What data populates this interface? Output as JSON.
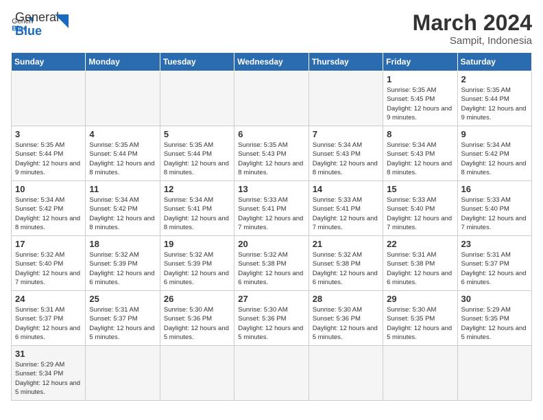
{
  "header": {
    "logo_general": "General",
    "logo_blue": "Blue",
    "month_year": "March 2024",
    "location": "Sampit, Indonesia"
  },
  "days_of_week": [
    "Sunday",
    "Monday",
    "Tuesday",
    "Wednesday",
    "Thursday",
    "Friday",
    "Saturday"
  ],
  "weeks": [
    [
      {
        "day": "",
        "info": ""
      },
      {
        "day": "",
        "info": ""
      },
      {
        "day": "",
        "info": ""
      },
      {
        "day": "",
        "info": ""
      },
      {
        "day": "",
        "info": ""
      },
      {
        "day": "1",
        "info": "Sunrise: 5:35 AM\nSunset: 5:45 PM\nDaylight: 12 hours and 9 minutes."
      },
      {
        "day": "2",
        "info": "Sunrise: 5:35 AM\nSunset: 5:44 PM\nDaylight: 12 hours and 9 minutes."
      }
    ],
    [
      {
        "day": "3",
        "info": "Sunrise: 5:35 AM\nSunset: 5:44 PM\nDaylight: 12 hours and 9 minutes."
      },
      {
        "day": "4",
        "info": "Sunrise: 5:35 AM\nSunset: 5:44 PM\nDaylight: 12 hours and 8 minutes."
      },
      {
        "day": "5",
        "info": "Sunrise: 5:35 AM\nSunset: 5:44 PM\nDaylight: 12 hours and 8 minutes."
      },
      {
        "day": "6",
        "info": "Sunrise: 5:35 AM\nSunset: 5:43 PM\nDaylight: 12 hours and 8 minutes."
      },
      {
        "day": "7",
        "info": "Sunrise: 5:34 AM\nSunset: 5:43 PM\nDaylight: 12 hours and 8 minutes."
      },
      {
        "day": "8",
        "info": "Sunrise: 5:34 AM\nSunset: 5:43 PM\nDaylight: 12 hours and 8 minutes."
      },
      {
        "day": "9",
        "info": "Sunrise: 5:34 AM\nSunset: 5:42 PM\nDaylight: 12 hours and 8 minutes."
      }
    ],
    [
      {
        "day": "10",
        "info": "Sunrise: 5:34 AM\nSunset: 5:42 PM\nDaylight: 12 hours and 8 minutes."
      },
      {
        "day": "11",
        "info": "Sunrise: 5:34 AM\nSunset: 5:42 PM\nDaylight: 12 hours and 8 minutes."
      },
      {
        "day": "12",
        "info": "Sunrise: 5:34 AM\nSunset: 5:41 PM\nDaylight: 12 hours and 8 minutes."
      },
      {
        "day": "13",
        "info": "Sunrise: 5:33 AM\nSunset: 5:41 PM\nDaylight: 12 hours and 7 minutes."
      },
      {
        "day": "14",
        "info": "Sunrise: 5:33 AM\nSunset: 5:41 PM\nDaylight: 12 hours and 7 minutes."
      },
      {
        "day": "15",
        "info": "Sunrise: 5:33 AM\nSunset: 5:40 PM\nDaylight: 12 hours and 7 minutes."
      },
      {
        "day": "16",
        "info": "Sunrise: 5:33 AM\nSunset: 5:40 PM\nDaylight: 12 hours and 7 minutes."
      }
    ],
    [
      {
        "day": "17",
        "info": "Sunrise: 5:32 AM\nSunset: 5:40 PM\nDaylight: 12 hours and 7 minutes."
      },
      {
        "day": "18",
        "info": "Sunrise: 5:32 AM\nSunset: 5:39 PM\nDaylight: 12 hours and 6 minutes."
      },
      {
        "day": "19",
        "info": "Sunrise: 5:32 AM\nSunset: 5:39 PM\nDaylight: 12 hours and 6 minutes."
      },
      {
        "day": "20",
        "info": "Sunrise: 5:32 AM\nSunset: 5:38 PM\nDaylight: 12 hours and 6 minutes."
      },
      {
        "day": "21",
        "info": "Sunrise: 5:32 AM\nSunset: 5:38 PM\nDaylight: 12 hours and 6 minutes."
      },
      {
        "day": "22",
        "info": "Sunrise: 5:31 AM\nSunset: 5:38 PM\nDaylight: 12 hours and 6 minutes."
      },
      {
        "day": "23",
        "info": "Sunrise: 5:31 AM\nSunset: 5:37 PM\nDaylight: 12 hours and 6 minutes."
      }
    ],
    [
      {
        "day": "24",
        "info": "Sunrise: 5:31 AM\nSunset: 5:37 PM\nDaylight: 12 hours and 6 minutes."
      },
      {
        "day": "25",
        "info": "Sunrise: 5:31 AM\nSunset: 5:37 PM\nDaylight: 12 hours and 5 minutes."
      },
      {
        "day": "26",
        "info": "Sunrise: 5:30 AM\nSunset: 5:36 PM\nDaylight: 12 hours and 5 minutes."
      },
      {
        "day": "27",
        "info": "Sunrise: 5:30 AM\nSunset: 5:36 PM\nDaylight: 12 hours and 5 minutes."
      },
      {
        "day": "28",
        "info": "Sunrise: 5:30 AM\nSunset: 5:36 PM\nDaylight: 12 hours and 5 minutes."
      },
      {
        "day": "29",
        "info": "Sunrise: 5:30 AM\nSunset: 5:35 PM\nDaylight: 12 hours and 5 minutes."
      },
      {
        "day": "30",
        "info": "Sunrise: 5:29 AM\nSunset: 5:35 PM\nDaylight: 12 hours and 5 minutes."
      }
    ],
    [
      {
        "day": "31",
        "info": "Sunrise: 5:29 AM\nSunset: 5:34 PM\nDaylight: 12 hours and 5 minutes."
      },
      {
        "day": "",
        "info": ""
      },
      {
        "day": "",
        "info": ""
      },
      {
        "day": "",
        "info": ""
      },
      {
        "day": "",
        "info": ""
      },
      {
        "day": "",
        "info": ""
      },
      {
        "day": "",
        "info": ""
      }
    ]
  ]
}
